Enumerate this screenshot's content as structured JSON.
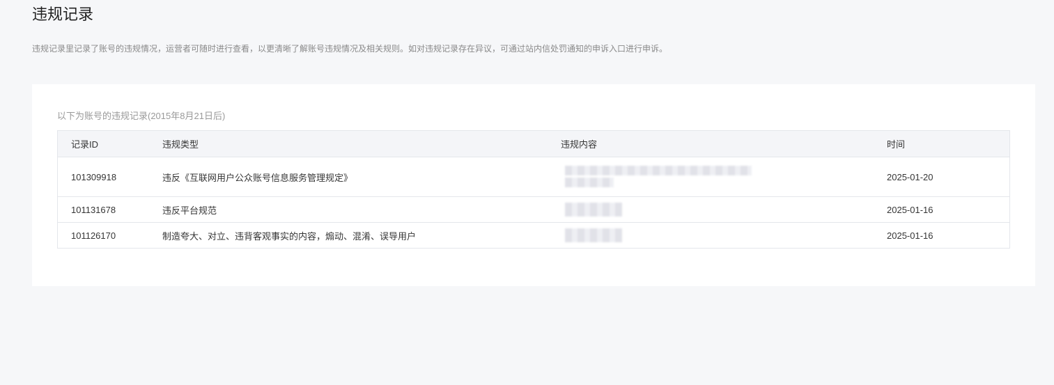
{
  "page": {
    "title": "违规记录",
    "description": "违规记录里记录了账号的违规情况，运营者可随时进行查看，以更清晰了解账号违规情况及相关规则。如对违规记录存在异议，可通过站内信处罚通知的申诉入口进行申诉。"
  },
  "panel": {
    "caption": "以下为账号的违规记录(2015年8月21日后)"
  },
  "table": {
    "headers": [
      "记录ID",
      "违规类型",
      "违规内容",
      "时间"
    ],
    "rows": [
      {
        "id": "101309918",
        "type": "违反《互联网用户公众账号信息服务管理规定》",
        "content": "",
        "time": "2025-01-20"
      },
      {
        "id": "101131678",
        "type": "违反平台规范",
        "content": "",
        "time": "2025-01-16"
      },
      {
        "id": "101126170",
        "type": "制造夸大、对立、违背客观事实的内容，煽动、混淆、误导用户",
        "content": "",
        "time": "2025-01-16"
      }
    ]
  }
}
